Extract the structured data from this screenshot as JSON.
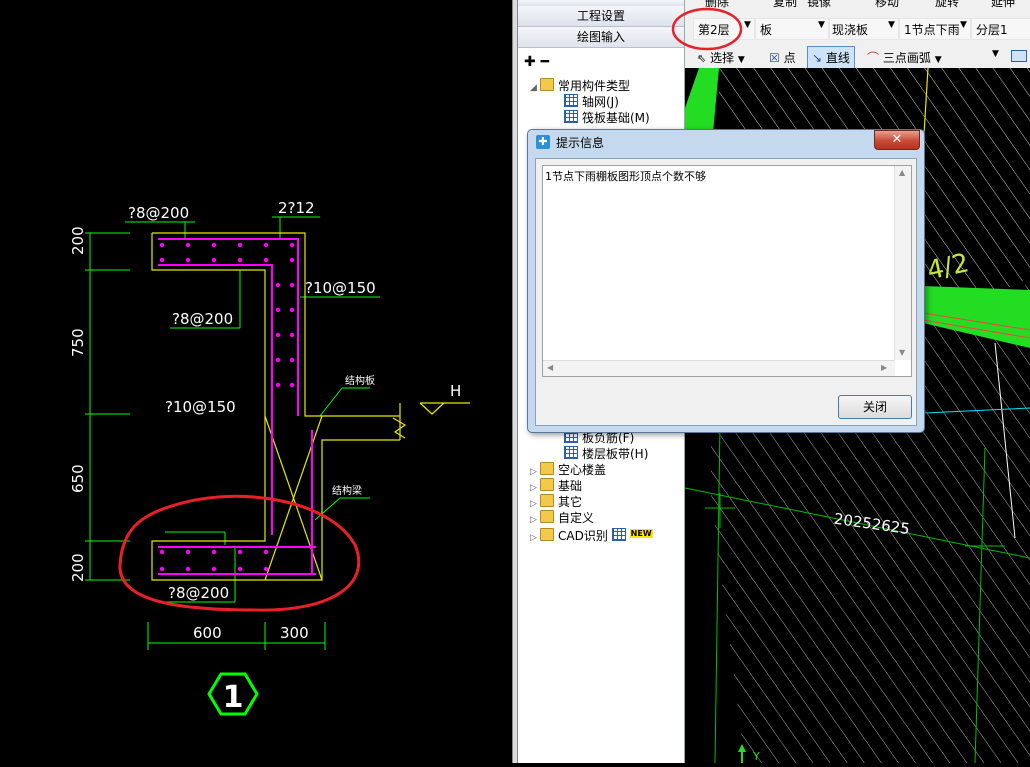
{
  "cad_left": {
    "dims_vertical": [
      "200",
      "750",
      "650",
      "200"
    ],
    "dims_horizontal": [
      "600",
      "300"
    ],
    "rebar_labels": [
      "?8@200",
      "2?12",
      "?10@150",
      "?8@200",
      "?10@150",
      "?8@200"
    ],
    "notes": [
      "结构板",
      "结构梁"
    ],
    "elevation": "H",
    "detail_number": "1"
  },
  "panel": {
    "btn_project": "工程设置",
    "btn_draw": "绘图输入",
    "tree": {
      "common_types": "常用构件类型",
      "axis": "轴网(J)",
      "raft": "筏板基础(M)",
      "neg_rebar": "板负筋(F)",
      "floor_strip": "楼层板带(H)",
      "hollow": "空心楼盖",
      "foundation": "基础",
      "other": "其它",
      "custom": "自定义",
      "cad": "CAD识别",
      "new_badge": "NEW"
    }
  },
  "toolbar": {
    "row0": [
      "删除",
      "复制",
      "镜像",
      "移动",
      "旋转",
      "延伸"
    ],
    "layer": "第2层",
    "type": "板",
    "sub_type": "现浇板",
    "component": "1节点下雨",
    "split": "分层1",
    "select": "选择",
    "point": "点",
    "line": "直线",
    "arc": "三点画弧"
  },
  "canvas": {
    "axis_label": "4/2",
    "code": "20252625",
    "y_axis": "Y"
  },
  "dialog": {
    "title": "提示信息",
    "message": "1节点下雨棚板图形顶点个数不够",
    "close": "关闭"
  }
}
